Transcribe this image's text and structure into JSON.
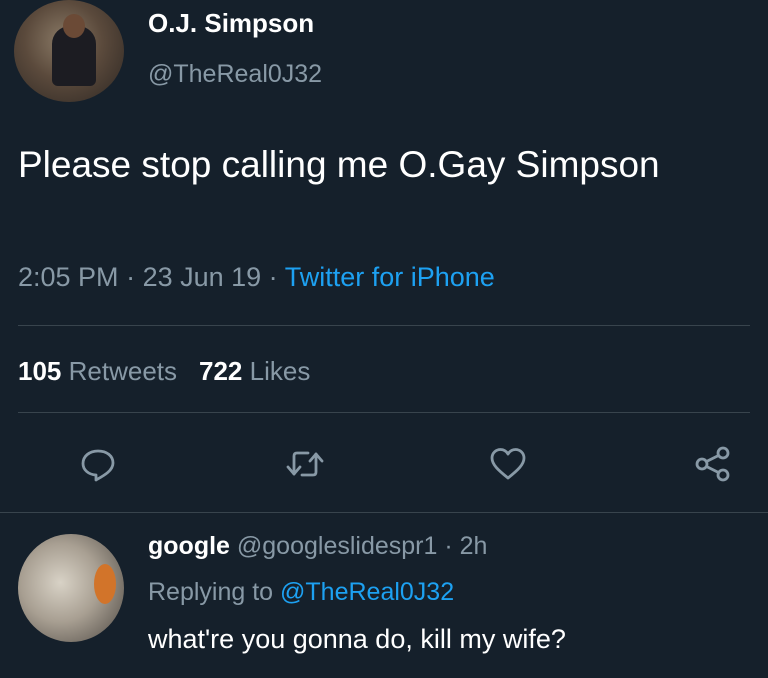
{
  "tweet": {
    "author_name": "O.J. Simpson",
    "author_handle": "@TheReal0J32",
    "text": "Please stop calling me O.Gay Simpson",
    "time": "2:05 PM",
    "separator": " · ",
    "date": "23 Jun 19",
    "source": "Twitter for iPhone",
    "retweets_count": "105",
    "retweets_label": "Retweets",
    "likes_count": "722",
    "likes_label": "Likes",
    "actions": [
      "reply-icon",
      "retweet-icon",
      "heart-icon",
      "share-icon"
    ]
  },
  "reply": {
    "author_name": "google",
    "author_handle": "@googleslidespr1",
    "separator": " · ",
    "time_ago": "2h",
    "replying_prefix": "Replying to ",
    "replying_to": "@TheReal0J32",
    "text": "what're you gonna do, kill my wife?"
  },
  "colors": {
    "background": "#15202b",
    "secondary_text": "#8899a6",
    "accent": "#1da1f2",
    "divider": "#38444d"
  }
}
